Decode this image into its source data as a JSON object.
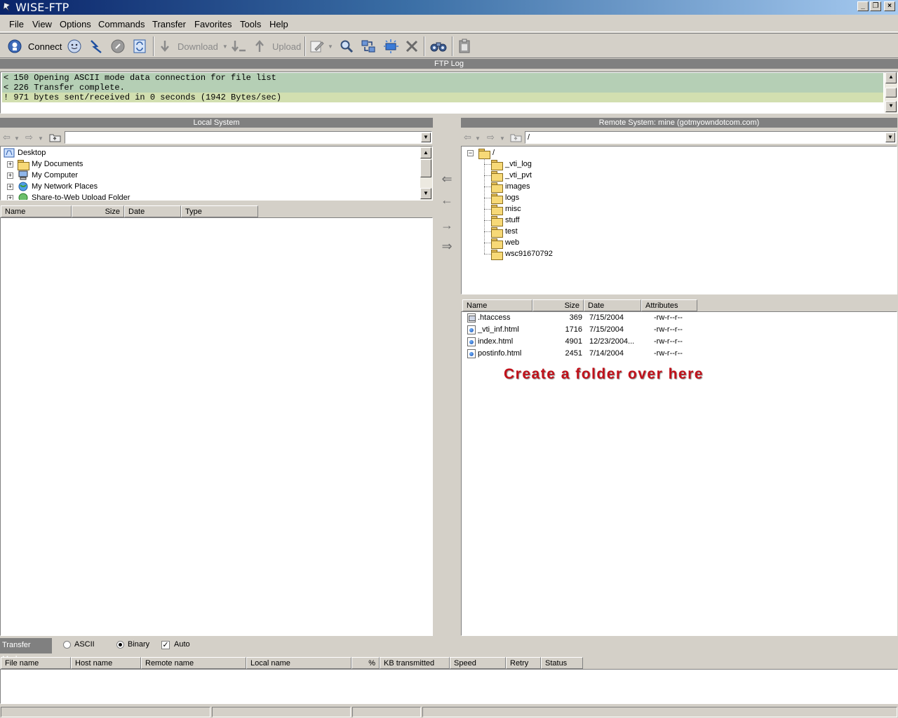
{
  "window": {
    "title": "WISE-FTP"
  },
  "menu": {
    "items": [
      "File",
      "View",
      "Options",
      "Commands",
      "Transfer",
      "Favorites",
      "Tools",
      "Help"
    ]
  },
  "toolbar": {
    "connect_label": "Connect",
    "download_label": "Download",
    "upload_label": "Upload"
  },
  "ftp_log": {
    "header": "FTP Log",
    "lines": [
      "< 150 Opening ASCII mode data connection for file list",
      "< 226 Transfer complete.",
      "! 971 bytes sent/received in 0 seconds (1942 Bytes/sec)"
    ]
  },
  "local": {
    "header": "Local System",
    "path": "",
    "tree": [
      {
        "label": "Desktop",
        "icon": "desktop-icon"
      },
      {
        "label": "My Documents",
        "icon": "documents-folder-icon"
      },
      {
        "label": "My Computer",
        "icon": "computer-icon"
      },
      {
        "label": "My Network Places",
        "icon": "network-icon"
      },
      {
        "label": "Share-to-Web Upload Folder",
        "icon": "web-folder-icon"
      }
    ],
    "columns": [
      "Name",
      "Size",
      "Date",
      "Type"
    ]
  },
  "remote": {
    "header": "Remote System: mine (gotmyowndotcom.com)",
    "path": "/",
    "root": "/",
    "folders": [
      "_vti_log",
      "_vti_pvt",
      "images",
      "logs",
      "misc",
      "stuff",
      "test",
      "web",
      "wsc91670792"
    ],
    "columns": [
      "Name",
      "Size",
      "Date",
      "Attributes"
    ],
    "files": [
      {
        "name": ".htaccess",
        "size": "369",
        "date": "7/15/2004",
        "attributes": "-rw-r--r--",
        "icon": "system-file-icon"
      },
      {
        "name": "_vti_inf.html",
        "size": "1716",
        "date": "7/15/2004",
        "attributes": "-rw-r--r--",
        "icon": "html-file-icon"
      },
      {
        "name": "index.html",
        "size": "4901",
        "date": "12/23/2004...",
        "attributes": "-rw-r--r--",
        "icon": "html-file-icon"
      },
      {
        "name": "postinfo.html",
        "size": "2451",
        "date": "7/14/2004",
        "attributes": "-rw-r--r--",
        "icon": "html-file-icon"
      }
    ],
    "annotation": "Create a folder over here"
  },
  "transfer_mode": {
    "label": "Transfer Mode",
    "options": [
      "ASCII",
      "Binary",
      "Auto"
    ],
    "selected": "Binary",
    "auto_checked": true
  },
  "queue": {
    "columns": [
      "File name",
      "Host name",
      "Remote name",
      "Local name",
      "%",
      "KB transmitted",
      "Speed",
      "Retry",
      "Status"
    ]
  },
  "colors": {
    "log_highlight": "#b5cfb5",
    "log_last": "#d2dfb0",
    "annotation": "#c1111a",
    "section_header": "#808080"
  }
}
